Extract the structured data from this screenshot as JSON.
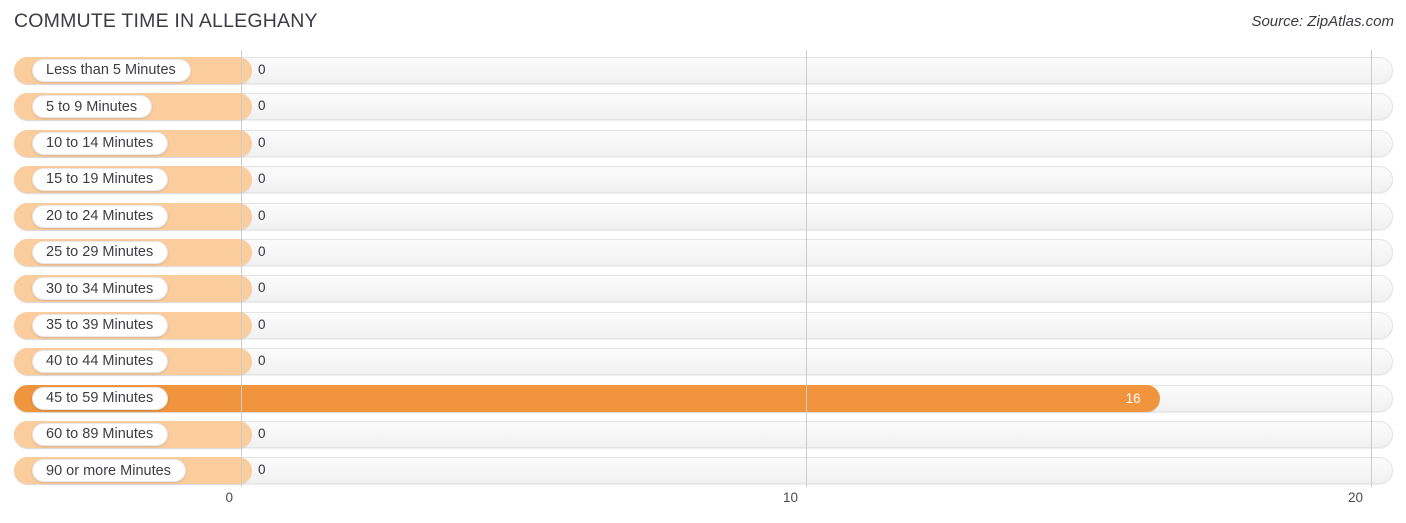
{
  "header": {
    "title": "COMMUTE TIME IN ALLEGHANY",
    "source": "Source: ZipAtlas.com"
  },
  "colors": {
    "bar_fill": "#f0943e",
    "bar_fill_light": "#fbcc9c",
    "track": "#f4f4f4",
    "gridline": "#cccccc",
    "title": "#3c3c44",
    "value_text": "#33333b",
    "value_text_inside": "#ffffff"
  },
  "chart_data": {
    "type": "bar",
    "orientation": "horizontal",
    "title": "COMMUTE TIME IN ALLEGHANY",
    "xlabel": "",
    "ylabel": "",
    "xlim": [
      0,
      20
    ],
    "xticks": [
      0,
      10,
      20
    ],
    "xtick_labels": [
      "0",
      "10",
      "20"
    ],
    "grid": true,
    "legend": false,
    "categories": [
      "Less than 5 Minutes",
      "5 to 9 Minutes",
      "10 to 14 Minutes",
      "15 to 19 Minutes",
      "20 to 24 Minutes",
      "25 to 29 Minutes",
      "30 to 34 Minutes",
      "35 to 39 Minutes",
      "40 to 44 Minutes",
      "45 to 59 Minutes",
      "60 to 89 Minutes",
      "90 or more Minutes"
    ],
    "values": [
      0,
      0,
      0,
      0,
      0,
      0,
      0,
      0,
      0,
      16,
      0,
      0
    ],
    "value_labels": [
      "0",
      "0",
      "0",
      "0",
      "0",
      "0",
      "0",
      "0",
      "0",
      "16",
      "0",
      "0"
    ]
  }
}
